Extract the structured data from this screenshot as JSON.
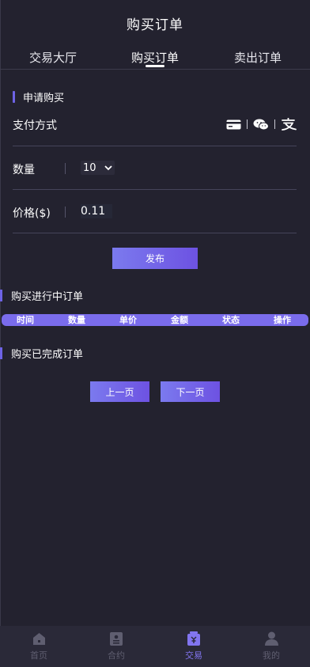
{
  "header": {
    "title": "购买订单"
  },
  "tabs": [
    {
      "label": "交易大厅",
      "active": false
    },
    {
      "label": "购买订单",
      "active": true
    },
    {
      "label": "卖出订单",
      "active": false
    }
  ],
  "form": {
    "section_title": "申请购买",
    "payment_label": "支付方式",
    "payment_icons": [
      "bank-card-icon",
      "wechat-icon",
      "alipay-icon"
    ],
    "quantity_label": "数量",
    "quantity_value": "10",
    "price_label": "价格($)",
    "price_value": "0.11",
    "publish_label": "发布"
  },
  "in_progress": {
    "title": "购买进行中订单",
    "columns": [
      "时间",
      "数量",
      "单价",
      "金额",
      "状态",
      "操作"
    ]
  },
  "completed": {
    "title": "购买已完成订单"
  },
  "pager": {
    "prev_label": "上一页",
    "next_label": "下一页"
  },
  "bottom_nav": [
    {
      "label": "首页",
      "icon": "home-icon",
      "active": false
    },
    {
      "label": "合约",
      "icon": "contract-icon",
      "active": false
    },
    {
      "label": "交易",
      "icon": "trade-icon",
      "active": true
    },
    {
      "label": "我的",
      "icon": "user-icon",
      "active": false
    }
  ],
  "colors": {
    "background": "#23222f",
    "accent": "#6e63e6",
    "nav_active": "#8275f0"
  }
}
